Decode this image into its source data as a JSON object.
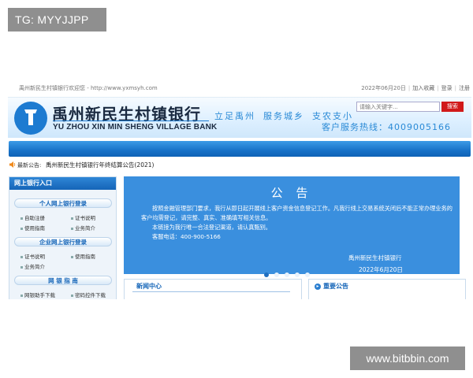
{
  "watermarks": {
    "top": "TG: MYYJJPP",
    "bottom": "www.bitbbin.com"
  },
  "topbar": {
    "welcome": "禹州新民生村镇银行欢迎您 - http://www.yxmsyh.com",
    "date": "2022年06月20日",
    "favorite": "加入收藏",
    "login": "登录",
    "register": "注册"
  },
  "header": {
    "bank_name_cn": "禹州新民生村镇银行",
    "bank_name_en": "YU ZHOU XIN MIN SHENG VILLAGE BANK",
    "slogan": [
      "立足禹州",
      "服务城乡",
      "支农支小"
    ],
    "hotline": "客户服务热线：4009005166",
    "search_placeholder": "请输入关键字...",
    "search_button": "搜索"
  },
  "notice": {
    "label": "最新公告:",
    "text": "禹州新民生村镇银行年终结算公告(2021)"
  },
  "sidebar": {
    "title": "网上银行入口",
    "personal": {
      "title": "个人网上银行登录",
      "items": [
        "自助注册",
        "证书说明",
        "使用指南",
        "业务简介"
      ]
    },
    "enterprise": {
      "title": "企业网上银行登录",
      "items": [
        "证书说明",
        "使用指南",
        "业务简介"
      ]
    },
    "guide": {
      "title": "网 银 指 南",
      "items": [
        "网银助手下载",
        "密码控件下载"
      ]
    }
  },
  "banner": {
    "title": "公 告",
    "paragraph1": "按照金融管理部门要求，我行从即日起开展线上客户资金信息登记工作。凡我行线上交易系统关闭后不能正常办理业务的客户均需登记，请完整、真实、准确填写相关信息。",
    "paragraph2": "本链接为我行唯一合法登记渠道，请认真甄别。",
    "phone": "客服电话：400-900-5166",
    "sign": "禹州新民生村镇银行",
    "date": "2022年6月20日"
  },
  "sections": {
    "news": "新闻中心",
    "announcements": "重要公告"
  },
  "colors": {
    "primary": "#1565b8",
    "accent": "#2a8ad6",
    "banner": "#3a8fde",
    "search_button": "#d11a1a"
  }
}
